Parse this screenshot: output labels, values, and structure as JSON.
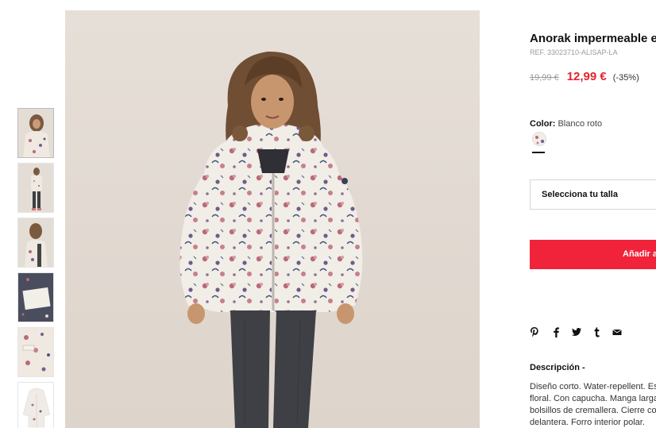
{
  "thumbnails": [
    {
      "alt": "front-portrait"
    },
    {
      "alt": "full-body"
    },
    {
      "alt": "side-view"
    },
    {
      "alt": "label-detail"
    },
    {
      "alt": "fabric-detail"
    },
    {
      "alt": "product-flat"
    }
  ],
  "product": {
    "title": "Anorak impermeable estampado",
    "ref": "REF. 33023710-ALISAP-LA",
    "old_price": "19,99 €",
    "new_price": "12,99 €",
    "discount": "(-35%)",
    "color_label": "Color:",
    "color_value": "Blanco roto",
    "size_placeholder": "Selecciona tu talla",
    "add_button": "Añadir a la cesta",
    "description_title": "Descripción -",
    "description_lines": [
      "Diseño corto. Water-repellent. Estampado",
      "floral. Con capucha. Manga larga. Dos",
      "bolsillos de cremallera. Cierre con cremallera",
      "delantera. Forro interior polar."
    ]
  },
  "social_icons": [
    "pinterest-icon",
    "facebook-icon",
    "twitter-icon",
    "tumblr-icon",
    "email-icon"
  ],
  "colors": {
    "sale_red": "#e2232e",
    "button_red": "#f0233a",
    "muted_text": "#9a9a9a",
    "image_bg": "#e2dbd4"
  }
}
